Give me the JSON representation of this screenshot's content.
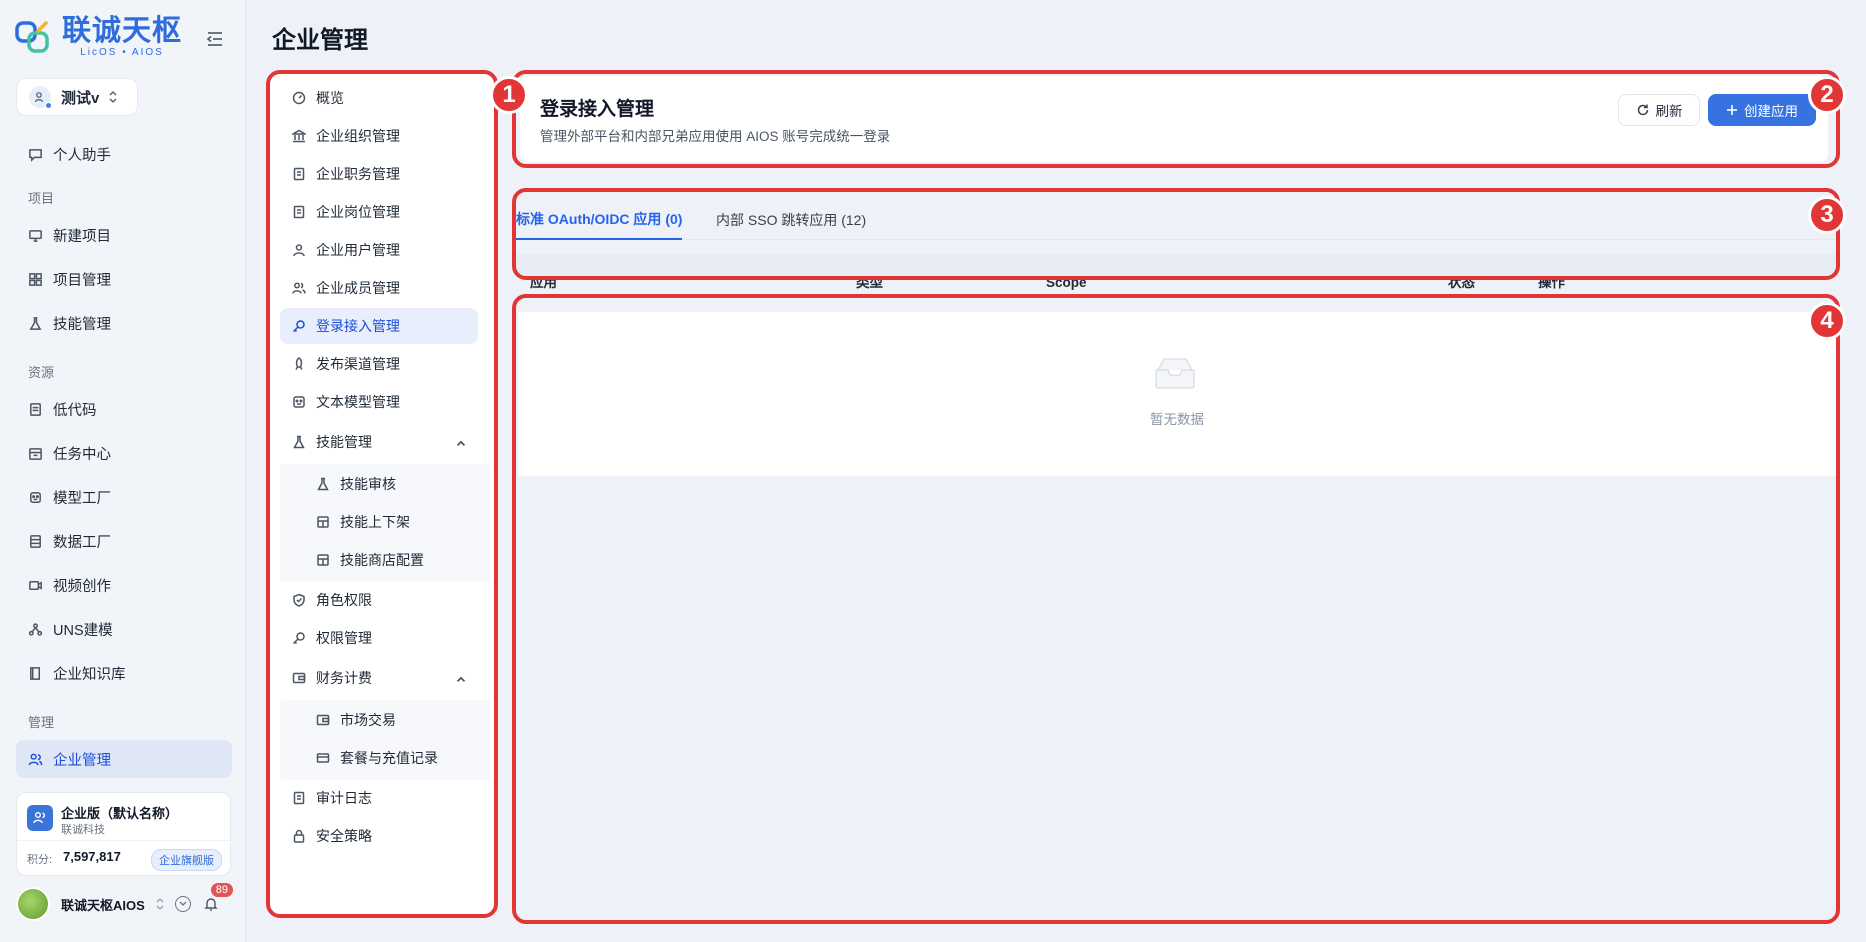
{
  "logo": {
    "title": "联诚天枢",
    "subtitle": "LicOS • AIOS"
  },
  "workspace": {
    "name": "测试v"
  },
  "sidebar": {
    "top_item": {
      "label": "个人助手",
      "icon": "chat-icon"
    },
    "sections": [
      {
        "title": "项目",
        "items": [
          {
            "label": "新建项目",
            "icon": "monitor-icon"
          },
          {
            "label": "项目管理",
            "icon": "grid-icon"
          },
          {
            "label": "技能管理",
            "icon": "flask-icon"
          }
        ]
      },
      {
        "title": "资源",
        "items": [
          {
            "label": "低代码",
            "icon": "document-icon"
          },
          {
            "label": "任务中心",
            "icon": "calendar-icon"
          },
          {
            "label": "模型工厂",
            "icon": "robot-icon"
          },
          {
            "label": "数据工厂",
            "icon": "database-icon"
          },
          {
            "label": "视频创作",
            "icon": "video-icon"
          },
          {
            "label": "UNS建模",
            "icon": "network-icon"
          },
          {
            "label": "企业知识库",
            "icon": "book-icon"
          }
        ]
      },
      {
        "title": "管理",
        "items": [
          {
            "label": "企业管理",
            "icon": "users-icon",
            "active": true
          }
        ]
      }
    ]
  },
  "plan_card": {
    "name": "企业版（默认名称）",
    "org": "联诚科技",
    "points_label": "积分:",
    "points": "7,597,817",
    "badge": "企业旗舰版"
  },
  "user": {
    "name": "联诚天枢AIOS",
    "notification_count": "89"
  },
  "page": {
    "title": "企业管理"
  },
  "sub_menu": {
    "items": [
      {
        "label": "概览",
        "icon": "dashboard-icon"
      },
      {
        "label": "企业组织管理",
        "icon": "bank-icon"
      },
      {
        "label": "企业职务管理",
        "icon": "clipboard-icon"
      },
      {
        "label": "企业岗位管理",
        "icon": "clipboard-icon"
      },
      {
        "label": "企业用户管理",
        "icon": "user-icon"
      },
      {
        "label": "企业成员管理",
        "icon": "users-icon"
      },
      {
        "label": "登录接入管理",
        "icon": "key-icon",
        "active": true
      },
      {
        "label": "发布渠道管理",
        "icon": "rocket-icon"
      },
      {
        "label": "文本模型管理",
        "icon": "robot-icon"
      },
      {
        "label": "技能管理",
        "icon": "flask-icon",
        "expanded": true
      },
      {
        "label": "技能审核",
        "icon": "flask-icon",
        "child": true
      },
      {
        "label": "技能上下架",
        "icon": "store-icon",
        "child": true
      },
      {
        "label": "技能商店配置",
        "icon": "store-icon",
        "child": true
      },
      {
        "label": "角色权限",
        "icon": "shield-icon"
      },
      {
        "label": "权限管理",
        "icon": "key-icon"
      },
      {
        "label": "财务计费",
        "icon": "wallet-icon",
        "expanded": true
      },
      {
        "label": "市场交易",
        "icon": "wallet-icon",
        "child": true
      },
      {
        "label": "套餐与充值记录",
        "icon": "card-icon",
        "child": true
      },
      {
        "label": "审计日志",
        "icon": "clipboard-icon"
      },
      {
        "label": "安全策略",
        "icon": "lock-icon"
      }
    ]
  },
  "header": {
    "title": "登录接入管理",
    "description": "管理外部平台和内部兄弟应用使用 AIOS 账号完成统一登录",
    "refresh_label": "刷新",
    "create_label": "创建应用"
  },
  "tabs": [
    {
      "label": "标准 OAuth/OIDC 应用 (0)",
      "active": true
    },
    {
      "label": "内部 SSO 跳转应用 (12)",
      "active": false
    }
  ],
  "table": {
    "columns": [
      "应用",
      "类型",
      "Scope",
      "状态",
      "操作"
    ],
    "empty_text": "暂无数据"
  },
  "annotations": [
    "1",
    "2",
    "3",
    "4"
  ],
  "colors": {
    "accent": "#3673e0",
    "annotation": "#e23636"
  }
}
